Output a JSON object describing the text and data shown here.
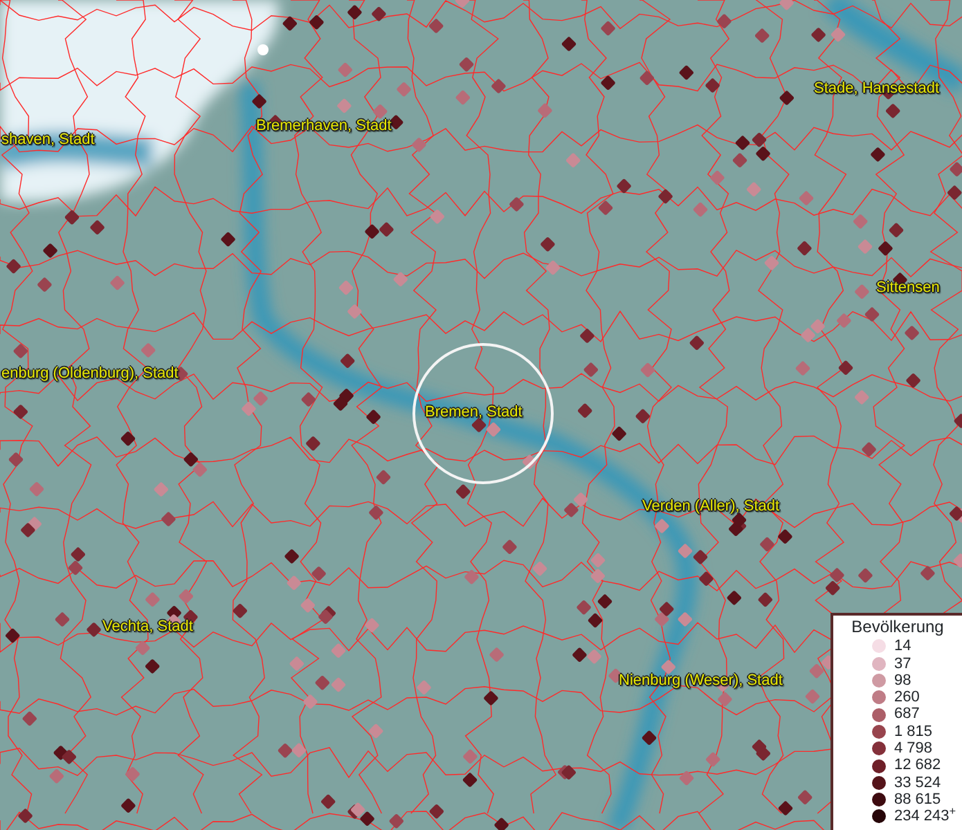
{
  "map": {
    "labels": [
      {
        "text": "shaven, Stadt"
      },
      {
        "text": "Bremerhaven, Stadt"
      },
      {
        "text": "Stade, Hansestadt"
      },
      {
        "text": "Sittensen"
      },
      {
        "text": "enburg (Oldenburg), Stadt"
      },
      {
        "text": "Bremen, Stadt"
      },
      {
        "text": "Verden (Aller), Stadt"
      },
      {
        "text": "Vechta, Stadt"
      },
      {
        "text": "Nienburg (Weser), Stadt"
      }
    ]
  },
  "legend": {
    "title": "Bevölkerung",
    "items": [
      {
        "label": "14",
        "color": "#f5dde5"
      },
      {
        "label": "37",
        "color": "#e0b5c0"
      },
      {
        "label": "98",
        "color": "#cf9aa3"
      },
      {
        "label": "260",
        "color": "#bf7c86"
      },
      {
        "label": "687",
        "color": "#ac5e68"
      },
      {
        "label": "1 815",
        "color": "#98444d"
      },
      {
        "label": "4 798",
        "color": "#84303a"
      },
      {
        "label": "12 682",
        "color": "#6e1f28"
      },
      {
        "label": "33 524",
        "color": "#55141a"
      },
      {
        "label": "88 615",
        "color": "#3e0b10"
      },
      {
        "label": "234 243$^{+}$",
        "color": "#260508"
      }
    ]
  }
}
